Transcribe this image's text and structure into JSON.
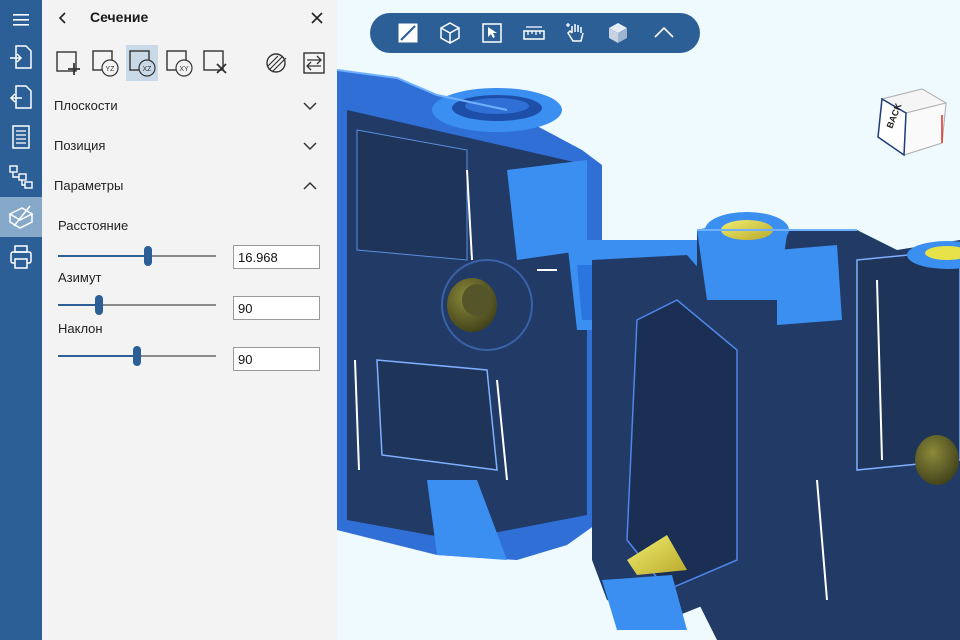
{
  "rail": {
    "items": [
      {
        "name": "menu-icon"
      },
      {
        "name": "import-icon"
      },
      {
        "name": "export-icon"
      },
      {
        "name": "document-icon"
      },
      {
        "name": "tree-icon"
      },
      {
        "name": "section-icon"
      },
      {
        "name": "print-icon"
      }
    ]
  },
  "panel": {
    "title": "Сечение",
    "tools": [
      {
        "name": "add-plane-icon",
        "label": ""
      },
      {
        "name": "plane-yz-icon",
        "label": "YZ"
      },
      {
        "name": "plane-xz-icon",
        "label": "XZ"
      },
      {
        "name": "plane-xy-icon",
        "label": "XY"
      },
      {
        "name": "delete-plane-icon",
        "label": ""
      }
    ],
    "sections": {
      "planes": "Плоскости",
      "position": "Позиция",
      "parameters": "Параметры"
    },
    "params": {
      "distance_label": "Расстояние",
      "distance_value": "16.968",
      "distance_fraction": 0.57,
      "azimuth_label": "Азимут",
      "azimuth_value": "90",
      "azimuth_fraction": 0.26,
      "tilt_label": "Наклон",
      "tilt_value": "90",
      "tilt_fraction": 0.5
    }
  },
  "viewcube": {
    "face_label": "BACK"
  },
  "colors": {
    "rail": "#2b5f96",
    "accent": "#2b5f96",
    "model_light": "#3a8ff0",
    "model_dark": "#223a66",
    "highlight": "#e8e24a"
  }
}
